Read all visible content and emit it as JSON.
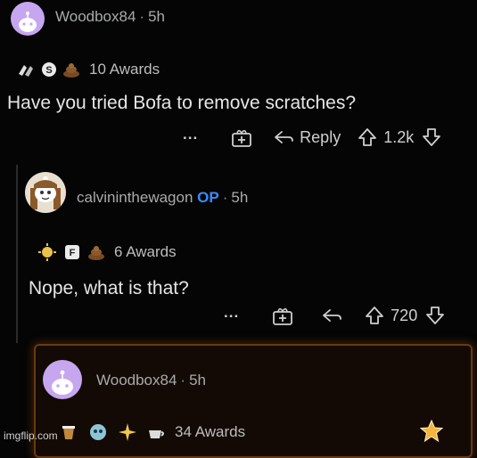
{
  "comments": [
    {
      "username": "Woodbox84",
      "age": "5h",
      "awards_label": "10 Awards",
      "body": "Have you tried Bofa to remove scratches?",
      "actions": {
        "more": "...",
        "reply": "Reply",
        "score": "1.2k"
      }
    },
    {
      "username": "calvininthewagon",
      "op_badge": "OP",
      "age": "5h",
      "awards_label": "6 Awards",
      "body": "Nope, what is that?",
      "actions": {
        "more": "...",
        "score": "720"
      }
    },
    {
      "username": "Woodbox84",
      "age": "5h",
      "awards_label": "34 Awards"
    }
  ],
  "separator": "·",
  "award_letters": {
    "s": "S",
    "f": "F"
  },
  "watermark": "imgflip.com",
  "colors": {
    "op": "#3a8bff",
    "highlight_border": "#6a3a10",
    "background": "#050505"
  }
}
